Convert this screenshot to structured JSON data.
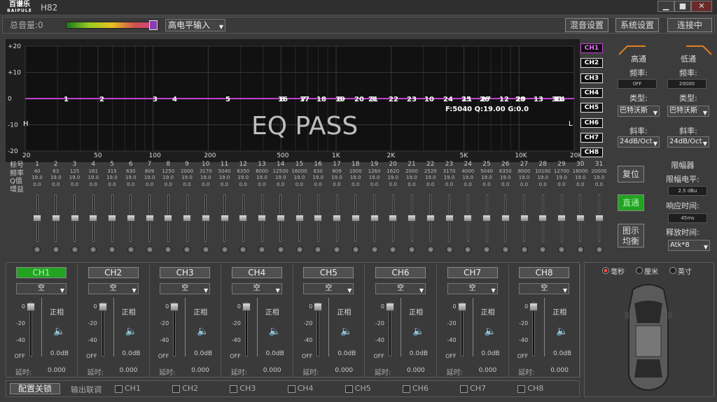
{
  "app": {
    "logo_cn": "百谱乐",
    "logo_en": "BAIPULE",
    "title": "H82",
    "btn_min": "▁",
    "btn_max": "■",
    "btn_close": "✕"
  },
  "topbar": {
    "volume_label": "总音量:0",
    "input_select": "高电平输入",
    "mixer": "混音设置",
    "system": "系统设置",
    "connect": "连接中"
  },
  "eq": {
    "center_text": "EQ PASS",
    "info": "F:5040 Q:19.00 G:0.0",
    "hp_mark": "H",
    "lp_mark": "L",
    "y_ticks": [
      "+20",
      "+10",
      "0",
      "-10",
      "-20"
    ],
    "x_ticks": [
      "20",
      "50",
      "100",
      "200",
      "500",
      "1K",
      "2K",
      "5K",
      "10K",
      "20K"
    ],
    "points": [
      "1",
      "2",
      "3",
      "4",
      "5",
      "16",
      "6",
      "17",
      "7",
      "18",
      "19",
      "8",
      "20",
      "21",
      "9",
      "22",
      "23",
      "10",
      "24",
      "25",
      "11",
      "26",
      "27",
      "12",
      "28",
      "29",
      "13",
      "30",
      "31",
      "14"
    ]
  },
  "channels_sel": [
    "CH1",
    "CH2",
    "CH3",
    "CH4",
    "CH5",
    "CH6",
    "CH7",
    "CH8"
  ],
  "highpass": {
    "title": "高通",
    "freq_label": "频率:",
    "freq": "0FF",
    "type_label": "类型:",
    "type": "巴特沃斯",
    "slope_label": "斜率:",
    "slope": "24dB/Oct"
  },
  "lowpass": {
    "title": "低通",
    "freq_label": "频率:",
    "freq": "20000",
    "type_label": "类型:",
    "type": "巴特沃斯",
    "slope_label": "斜率:",
    "slope": "24dB/Oct"
  },
  "side": {
    "reset": "复位",
    "bypass": "直通",
    "graphic_1": "图示",
    "graphic_2": "均衡"
  },
  "limiter": {
    "title": "限幅器",
    "level_label": "限幅电平:",
    "level": "2.5 dBu",
    "attack_label": "响应时间:",
    "attack": "45ms",
    "release_label": "释放时间:",
    "release": "Atk*8"
  },
  "bandlabels": {
    "num": "标号",
    "freq": "频率",
    "q": "Q值",
    "gain": "增益"
  },
  "bands": [
    {
      "n": "1",
      "f": "40",
      "q": "19.0",
      "g": "0.0"
    },
    {
      "n": "2",
      "f": "63",
      "q": "19.0",
      "g": "0.0"
    },
    {
      "n": "3",
      "f": "125",
      "q": "19.0",
      "g": "0.0"
    },
    {
      "n": "4",
      "f": "161",
      "q": "19.0",
      "g": "0.0"
    },
    {
      "n": "5",
      "f": "315",
      "q": "19.0",
      "g": "0.0"
    },
    {
      "n": "6",
      "f": "630",
      "q": "19.0",
      "g": "0.0"
    },
    {
      "n": "7",
      "f": "809",
      "q": "19.0",
      "g": "0.0"
    },
    {
      "n": "8",
      "f": "1250",
      "q": "19.0",
      "g": "0.0"
    },
    {
      "n": "9",
      "f": "2000",
      "q": "19.0",
      "g": "0.0"
    },
    {
      "n": "10",
      "f": "3170",
      "q": "19.0",
      "g": "0.0"
    },
    {
      "n": "11",
      "f": "5040",
      "q": "19.0",
      "g": "0.0"
    },
    {
      "n": "12",
      "f": "6350",
      "q": "19.0",
      "g": "0.0"
    },
    {
      "n": "13",
      "f": "8000",
      "q": "19.0",
      "g": "0.0"
    },
    {
      "n": "14",
      "f": "12500",
      "q": "19.0",
      "g": "0.0"
    },
    {
      "n": "15",
      "f": "16000",
      "q": "19.0",
      "g": "0.0"
    },
    {
      "n": "16",
      "f": "630",
      "q": "19.0",
      "g": "0.0"
    },
    {
      "n": "17",
      "f": "809",
      "q": "19.0",
      "g": "0.0"
    },
    {
      "n": "18",
      "f": "1000",
      "q": "19.0",
      "g": "0.0"
    },
    {
      "n": "19",
      "f": "1260",
      "q": "19.0",
      "g": "0.0"
    },
    {
      "n": "20",
      "f": "1620",
      "q": "19.0",
      "g": "0.0"
    },
    {
      "n": "21",
      "f": "2000",
      "q": "19.0",
      "g": "0.0"
    },
    {
      "n": "22",
      "f": "2520",
      "q": "19.0",
      "g": "0.0"
    },
    {
      "n": "23",
      "f": "3170",
      "q": "19.0",
      "g": "0.0"
    },
    {
      "n": "24",
      "f": "4000",
      "q": "19.0",
      "g": "0.0"
    },
    {
      "n": "25",
      "f": "5040",
      "q": "19.0",
      "g": "0.0"
    },
    {
      "n": "26",
      "f": "6350",
      "q": "19.0",
      "g": "0.0"
    },
    {
      "n": "27",
      "f": "8000",
      "q": "19.0",
      "g": "0.0"
    },
    {
      "n": "28",
      "f": "10100",
      "q": "19.0",
      "g": "0.0"
    },
    {
      "n": "29",
      "f": "12700",
      "q": "19.0",
      "g": "0.0"
    },
    {
      "n": "30",
      "f": "16000",
      "q": "19.0",
      "g": "0.0"
    },
    {
      "n": "31",
      "f": "20000",
      "q": "19.0",
      "g": "0.0"
    }
  ],
  "outputs": {
    "mode": "空",
    "phase": "正相",
    "scale": [
      "0",
      "-20",
      "-40",
      "OFF"
    ],
    "gain": "0.0dB",
    "delay_label": "延时:",
    "delay": "0.000",
    "names": [
      "CH1",
      "CH2",
      "CH3",
      "CH4",
      "CH5",
      "CH6",
      "CH7",
      "CH8"
    ]
  },
  "bottom": {
    "lock": "配置关锁",
    "link_label": "输出联调",
    "links": [
      "CH1",
      "CH2",
      "CH3",
      "CH4",
      "CH5",
      "CH6",
      "CH7",
      "CH8"
    ]
  },
  "units": {
    "ms": "毫秒",
    "cm": "厘米",
    "inch": "英寸"
  },
  "colors": {
    "accent": "#b030c0",
    "active_green": "#22a322",
    "curve": "#c040d0"
  }
}
